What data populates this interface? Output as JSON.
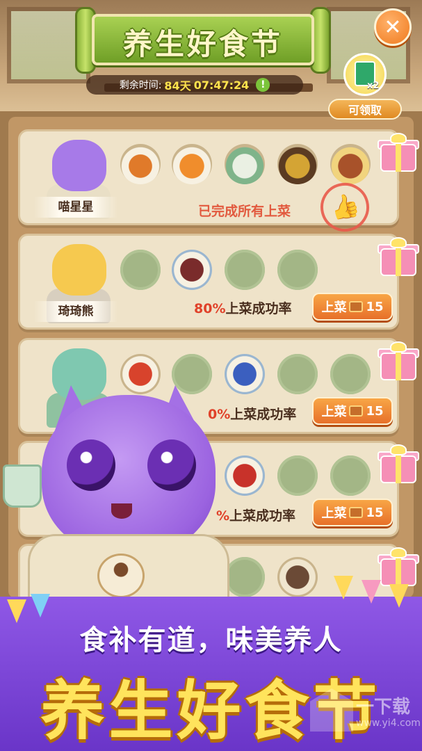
{
  "header": {
    "title": "养生好食节",
    "timer_label": "剩余时间:",
    "timer_days": "84天",
    "timer_time": "07:47:24",
    "timer_alert": "!",
    "close_symbol": "✕"
  },
  "reward": {
    "count": "x2",
    "claim_label": "可领取"
  },
  "rows": [
    {
      "name": "喵星星",
      "done_text": "已完成所有上菜",
      "stamp": "👍"
    },
    {
      "name": "琦琦熊",
      "rate": "80%",
      "rate_suffix": "上菜成功率",
      "serve_label": "上菜",
      "cost": "15"
    },
    {
      "name": "",
      "rate": "0%",
      "rate_suffix": "上菜成功率",
      "serve_label": "上菜",
      "cost": "15"
    },
    {
      "name": "",
      "rate": "%",
      "rate_suffix": "上菜成功率",
      "serve_label": "上菜",
      "cost": "15"
    }
  ],
  "promo": {
    "slogan": "食补有道，味美养人",
    "title": "养生好食节"
  },
  "watermark": {
    "brand": "一下载",
    "url": "www.yi4.com"
  },
  "colors": {
    "accent_orange": "#e7702a",
    "title_green": "#6f9f26",
    "promo_purple": "#7b44d6",
    "promo_yellow": "#ffe45c",
    "done_red": "#e25a3f"
  }
}
